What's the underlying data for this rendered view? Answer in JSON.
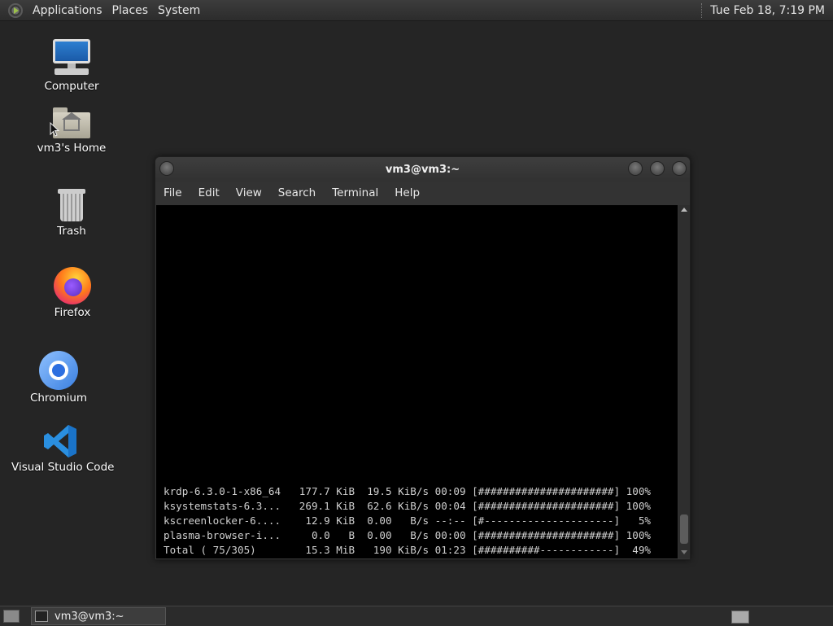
{
  "top_panel": {
    "menus": [
      "Applications",
      "Places",
      "System"
    ],
    "clock": "Tue Feb 18,  7:19 PM",
    "logo_icon": "mate-logo-icon"
  },
  "desktop_icons": [
    {
      "label": "Computer",
      "icon": "computer-icon"
    },
    {
      "label": "vm3's Home",
      "icon": "home-folder-icon"
    },
    {
      "label": "Trash",
      "icon": "trash-icon"
    },
    {
      "label": "Firefox",
      "icon": "firefox-icon"
    },
    {
      "label": "Chromium",
      "icon": "chromium-icon"
    },
    {
      "label": "Visual Studio Code",
      "icon": "vscode-icon"
    }
  ],
  "terminal": {
    "title": "vm3@vm3:~",
    "menu": [
      "File",
      "Edit",
      "View",
      "Search",
      "Terminal",
      "Help"
    ],
    "lines": [
      "krdp-6.3.0-1-x86_64   177.7 KiB  19.5 KiB/s 00:09 [######################] 100%",
      "ksystemstats-6.3...   269.1 KiB  62.6 KiB/s 00:04 [######################] 100%",
      "kscreenlocker-6....    12.9 KiB  0.00   B/s --:-- [#---------------------]   5%",
      "plasma-browser-i...     0.0   B  0.00   B/s 00:00 [######################] 100%",
      "Total ( 75/305)        15.3 MiB   190 KiB/s 01:23 [##########------------]  49%"
    ]
  },
  "taskbar": {
    "task_label": "vm3@vm3:~"
  }
}
